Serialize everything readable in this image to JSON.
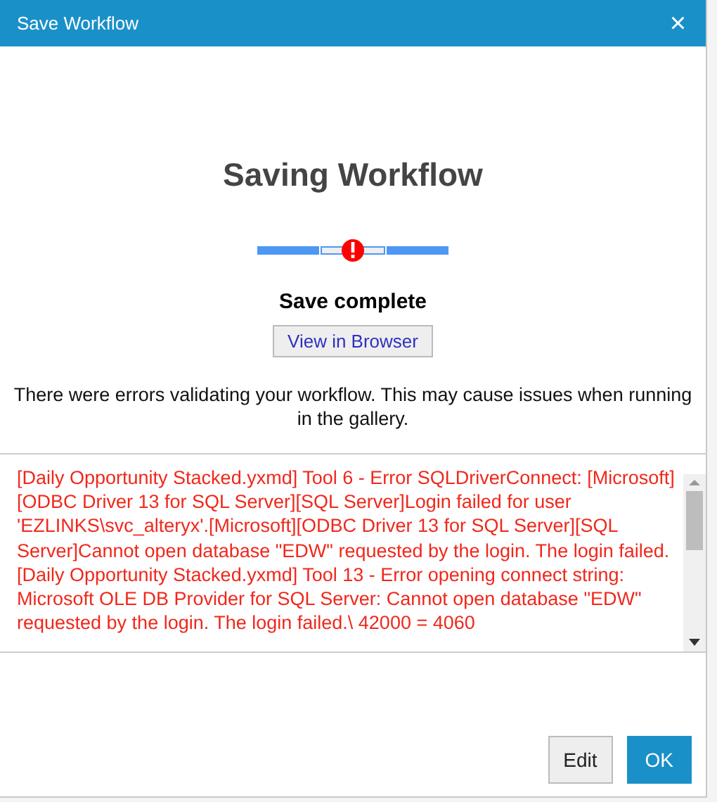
{
  "window": {
    "title": "Save Workflow",
    "close": "×"
  },
  "heading": "Saving Workflow",
  "status": "Save complete",
  "view_button": "View in Browser",
  "message": "There were errors validating your workflow. This may cause issues when running in the gallery.",
  "log": [
    {
      "kind": "error",
      "text": "[Daily Opportunity Stacked.yxmd] Tool 6 - Error SQLDriverConnect: [Microsoft][ODBC Driver 13 for SQL Server][SQL Server]Login failed for user 'EZLINKS\\svc_alteryx'.[Microsoft][ODBC Driver 13 for SQL Server][SQL Server]Cannot open database \"EDW\" requested by the login. The login failed."
    },
    {
      "kind": "error",
      "text": "[Daily Opportunity Stacked.yxmd] Tool 13 - Error opening connect string: Microsoft OLE DB Provider for SQL Server: Cannot open database \"EDW\" requested by the login. The login failed.\\ 42000 = 4060"
    }
  ],
  "buttons": [
    {
      "label": "Edit",
      "kind": "secondary"
    },
    {
      "label": "OK",
      "kind": "primary"
    }
  ]
}
